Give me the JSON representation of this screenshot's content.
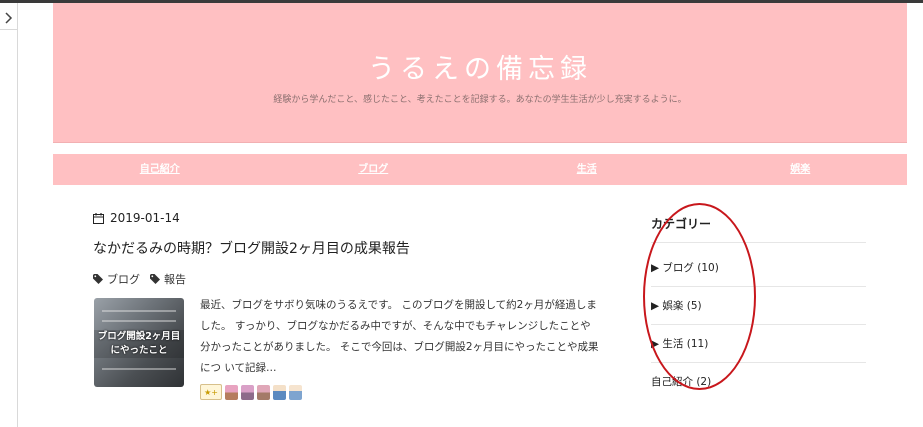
{
  "site": {
    "title": "うるえの備忘録",
    "description": "経験から学んだこと、感じたこと、考えたことを記録する。あなたの学生生活が少し充実するように。"
  },
  "nav": {
    "items": [
      "自己紹介",
      "ブログ",
      "生活",
      "娯楽"
    ]
  },
  "post": {
    "date": "2019-01-14",
    "title": "なかだるみの時期？ブログ開設2ヶ月目の成果報告",
    "tags": [
      "ブログ",
      "報告"
    ],
    "thumbnail_text": [
      "ブログ開設2ヶ月目",
      "にやったこと"
    ],
    "excerpt": "最近、ブログをサボり気味のうるえです。 このブログを開設して約2ヶ月が経過しました。 すっかり、ブログなかだるみ中ですが、そんな中でもチャレンジしたことや分かったことがありました。 そこで今回は、ブログ開設2ヶ月目にやったことや成果につ いて記録…",
    "star_label": "★+"
  },
  "sidebar": {
    "title": "カテゴリー",
    "categories": [
      "▶ ブログ (10)",
      "▶ 娯楽 (5)",
      "▶ 生活 (11)",
      "自己紹介 (2)"
    ]
  },
  "colors": {
    "header_bg": "#ffc0c2",
    "annotation": "#c8171c"
  }
}
